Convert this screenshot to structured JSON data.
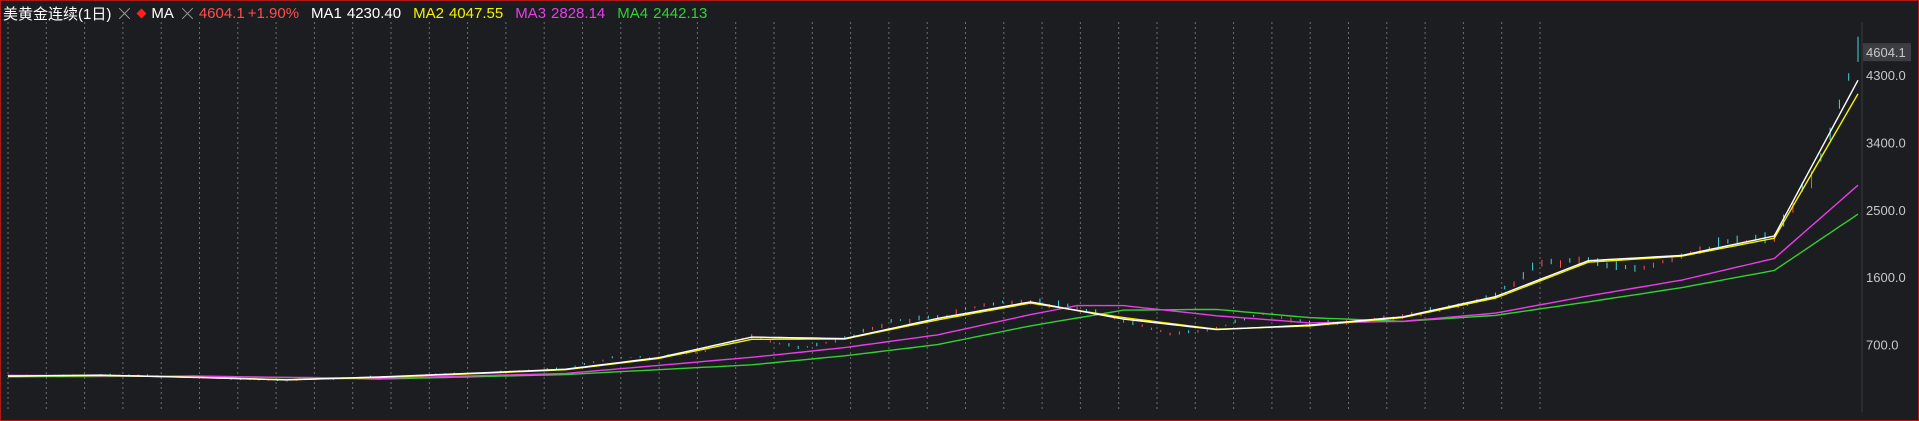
{
  "header": {
    "symbol": "美黄金连续(1日)",
    "indicator": "MA",
    "last_value": "4604.1",
    "change": "+1.90%",
    "ma1_label": "MA1",
    "ma1_value": "4230.40",
    "ma2_label": "MA2",
    "ma2_value": "4047.55",
    "ma3_label": "MA3",
    "ma3_value": "2828.14",
    "ma4_label": "MA4",
    "ma4_value": "2442.13"
  },
  "colors": {
    "background": "#1c1d21",
    "up": "#ff4d4d",
    "down": "#3fd8e0",
    "ma1": "#ffffff",
    "ma2": "#f3f300",
    "ma3": "#e83ee8",
    "ma4": "#32d132",
    "grid": "#8a8a8a",
    "border": "#b01818"
  },
  "chart_data": {
    "type": "line",
    "title": "美黄金连续(1日)",
    "y_ticks": [
      4300.0,
      3400.0,
      2500.0,
      1600.0,
      700.0
    ],
    "y_tick_labels": [
      "4300.0",
      "3400.0",
      "2500.0",
      "1600.0",
      "700.0"
    ],
    "last_price_label": "4604.1",
    "last_price": 4604.1,
    "ylim": [
      -200,
      4900
    ],
    "grid": "vertical dashed",
    "series_points": 200,
    "price": {
      "x": [
        0,
        5,
        10,
        15,
        20,
        25,
        30,
        35,
        40,
        45,
        50,
        55,
        60,
        65,
        70,
        75,
        80,
        85,
        90,
        95,
        100,
        105,
        110,
        115,
        120,
        125,
        130,
        135,
        140,
        145,
        150,
        155,
        160,
        165,
        170,
        175,
        180,
        185,
        190,
        195,
        199
      ],
      "y": [
        285,
        290,
        295,
        288,
        260,
        240,
        225,
        245,
        270,
        300,
        320,
        345,
        380,
        520,
        530,
        620,
        820,
        650,
        780,
        1010,
        1060,
        1240,
        1280,
        1185,
        1030,
        850,
        910,
        1125,
        970,
        1010,
        1080,
        1200,
        1350,
        1790,
        1830,
        1680,
        1910,
        2060,
        2130,
        3150,
        4604
      ]
    },
    "series": [
      {
        "name": "MA1",
        "value": 4230.4,
        "x": [
          0,
          10,
          20,
          30,
          40,
          50,
          60,
          70,
          80,
          90,
          100,
          110,
          120,
          130,
          140,
          150,
          160,
          170,
          180,
          190,
          199
        ],
        "y": [
          280,
          292,
          262,
          228,
          268,
          318,
          372,
          525,
          800,
          780,
          1050,
          1270,
          1040,
          900,
          960,
          1070,
          1340,
          1820,
          1890,
          2150,
          4230
        ]
      },
      {
        "name": "MA2",
        "value": 4047.55,
        "x": [
          0,
          10,
          20,
          30,
          40,
          50,
          60,
          70,
          80,
          90,
          100,
          110,
          120,
          130,
          140,
          150,
          160,
          170,
          180,
          190,
          199
        ],
        "y": [
          278,
          290,
          265,
          230,
          262,
          312,
          365,
          515,
          770,
          775,
          1030,
          1255,
          1060,
          905,
          950,
          1060,
          1320,
          1800,
          1880,
          2120,
          4047
        ]
      },
      {
        "name": "MA3",
        "value": 2828.14,
        "x": [
          0,
          20,
          40,
          60,
          80,
          90,
          100,
          110,
          115,
          120,
          130,
          140,
          150,
          160,
          170,
          180,
          190,
          199
        ],
        "y": [
          290,
          275,
          250,
          315,
          530,
          660,
          830,
          1100,
          1220,
          1220,
          1085,
          990,
          1010,
          1120,
          1350,
          1560,
          1850,
          2828
        ]
      },
      {
        "name": "MA4",
        "value": 2442.13,
        "x": [
          0,
          20,
          40,
          60,
          80,
          90,
          100,
          110,
          120,
          130,
          140,
          150,
          160,
          170,
          180,
          190,
          199
        ],
        "y": [
          270,
          280,
          240,
          300,
          430,
          550,
          700,
          950,
          1160,
          1170,
          1060,
          1010,
          1090,
          1270,
          1460,
          1690,
          2442
        ]
      }
    ]
  }
}
